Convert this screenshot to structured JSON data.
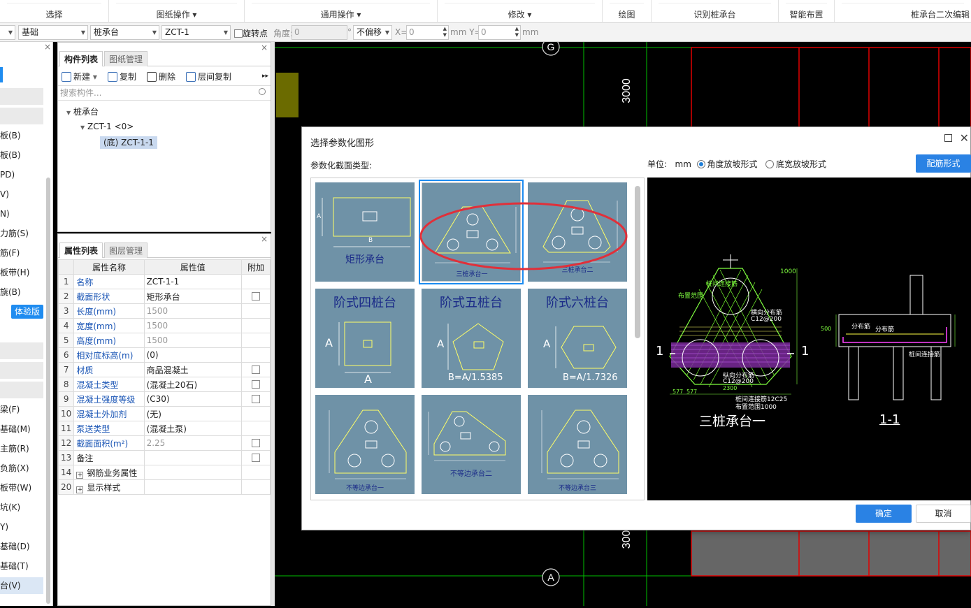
{
  "ribbon": {
    "groups": [
      "选择",
      "图纸操作",
      "通用操作",
      "修改",
      "绘图",
      "识别桩承台",
      "智能布置",
      "桩承台二次编辑"
    ]
  },
  "options": {
    "floor": "基础",
    "category": "桩承台",
    "component": "ZCT-1",
    "rotate_label": "旋转点",
    "angle_label": "角度:",
    "angle_value": "0",
    "degree_sign": "°",
    "offset_mode": "不偏移",
    "x_label": "X=",
    "x_value": "0",
    "mm_y_label": "mm Y=",
    "y_value": "0",
    "mm_label": "mm"
  },
  "leftnav": {
    "items": [
      "板(B)",
      "板(B)",
      "PD)",
      "V)",
      "N)",
      "力筋(S)",
      "筋(F)",
      "板带(H)",
      "旐(B)",
      "梁(F)",
      "基础(M)",
      "主筋(R)",
      "负筋(X)",
      "板带(W)",
      "坑(K)",
      "Y)",
      "基础(D)",
      "基础(T)",
      "台(V)"
    ],
    "trial_badge": "体验版"
  },
  "comp_panel": {
    "tabs": [
      "构件列表",
      "图纸管理"
    ],
    "toolbar": [
      "新建",
      "复制",
      "删除",
      "层间复制"
    ],
    "new_dropdown": "▾",
    "more": "▸▸",
    "search_placeholder": "搜索构件...",
    "tree_root": "桩承台",
    "tree_child": "ZCT-1 <0>",
    "tree_leaf": "(底) ZCT-1-1"
  },
  "prop_panel": {
    "tabs": [
      "属性列表",
      "图层管理"
    ],
    "headers": [
      "属性名称",
      "属性值",
      "附加"
    ],
    "rows": [
      {
        "num": "1",
        "name": "名称",
        "value": "ZCT-1-1"
      },
      {
        "num": "2",
        "name": "截面形状",
        "value": "矩形承台"
      },
      {
        "num": "3",
        "name": "长度(mm)",
        "value": "1500"
      },
      {
        "num": "4",
        "name": "宽度(mm)",
        "value": "1500"
      },
      {
        "num": "5",
        "name": "高度(mm)",
        "value": "1500"
      },
      {
        "num": "6",
        "name": "相对底标高(m)",
        "value": "(0)"
      },
      {
        "num": "7",
        "name": "材质",
        "value": "商品混凝土"
      },
      {
        "num": "8",
        "name": "混凝土类型",
        "value": "(混凝土20石)"
      },
      {
        "num": "9",
        "name": "混凝土强度等级",
        "value": "(C30)"
      },
      {
        "num": "10",
        "name": "混凝土外加剂",
        "value": "(无)"
      },
      {
        "num": "11",
        "name": "泵送类型",
        "value": "(混凝土泵)"
      },
      {
        "num": "12",
        "name": "截面面积(m²)",
        "value": "2.25"
      },
      {
        "num": "13",
        "name": "备注",
        "value": ""
      },
      {
        "num": "14",
        "name": "钢筋业务属性",
        "value": ""
      },
      {
        "num": "20",
        "name": "显示样式",
        "value": ""
      }
    ]
  },
  "cad": {
    "axis_top": "G",
    "axis_bottom": "A",
    "dim_top": "3000",
    "dim_bottom": "300"
  },
  "dialog": {
    "title": "选择参数化图形",
    "section_type_label": "参数化截面类型:",
    "unit_label": "单位:",
    "unit_value": "mm",
    "radio_angle": "角度放坡形式",
    "radio_width": "底宽放坡形式",
    "rebar_button": "配筋形式",
    "ok": "确定",
    "cancel": "取消",
    "shapes": [
      {
        "label": "矩形承台",
        "dims": [
          "A",
          "B"
        ]
      },
      {
        "label": "三桩承台一"
      },
      {
        "label": "三桩承台二"
      },
      {
        "label": "阶式四桩台",
        "dims": [
          "A",
          "A"
        ]
      },
      {
        "label": "阶式五桩台",
        "dims": [
          "A",
          "B=A/1.5385"
        ]
      },
      {
        "label": "阶式六桩台",
        "dims": [
          "A",
          "B=A/1.7326"
        ]
      },
      {
        "label": "不等边承台一"
      },
      {
        "label": "不等边承台二"
      },
      {
        "label": "不等边承台三"
      }
    ],
    "preview": {
      "title": "三桩承台一",
      "section": "1-1",
      "mark_left": "1",
      "mark_right": "1",
      "notes": [
        "桩间连接筋",
        "布置范围",
        "1000",
        "横向分布筋",
        "C12@200",
        "纵向分布筋",
        "C12@200",
        "桩间连接筋12C25",
        "布置范围1000",
        "577",
        "577",
        "2300",
        "分布筋",
        "分布筋",
        "桩间连接筋",
        "500"
      ]
    }
  }
}
